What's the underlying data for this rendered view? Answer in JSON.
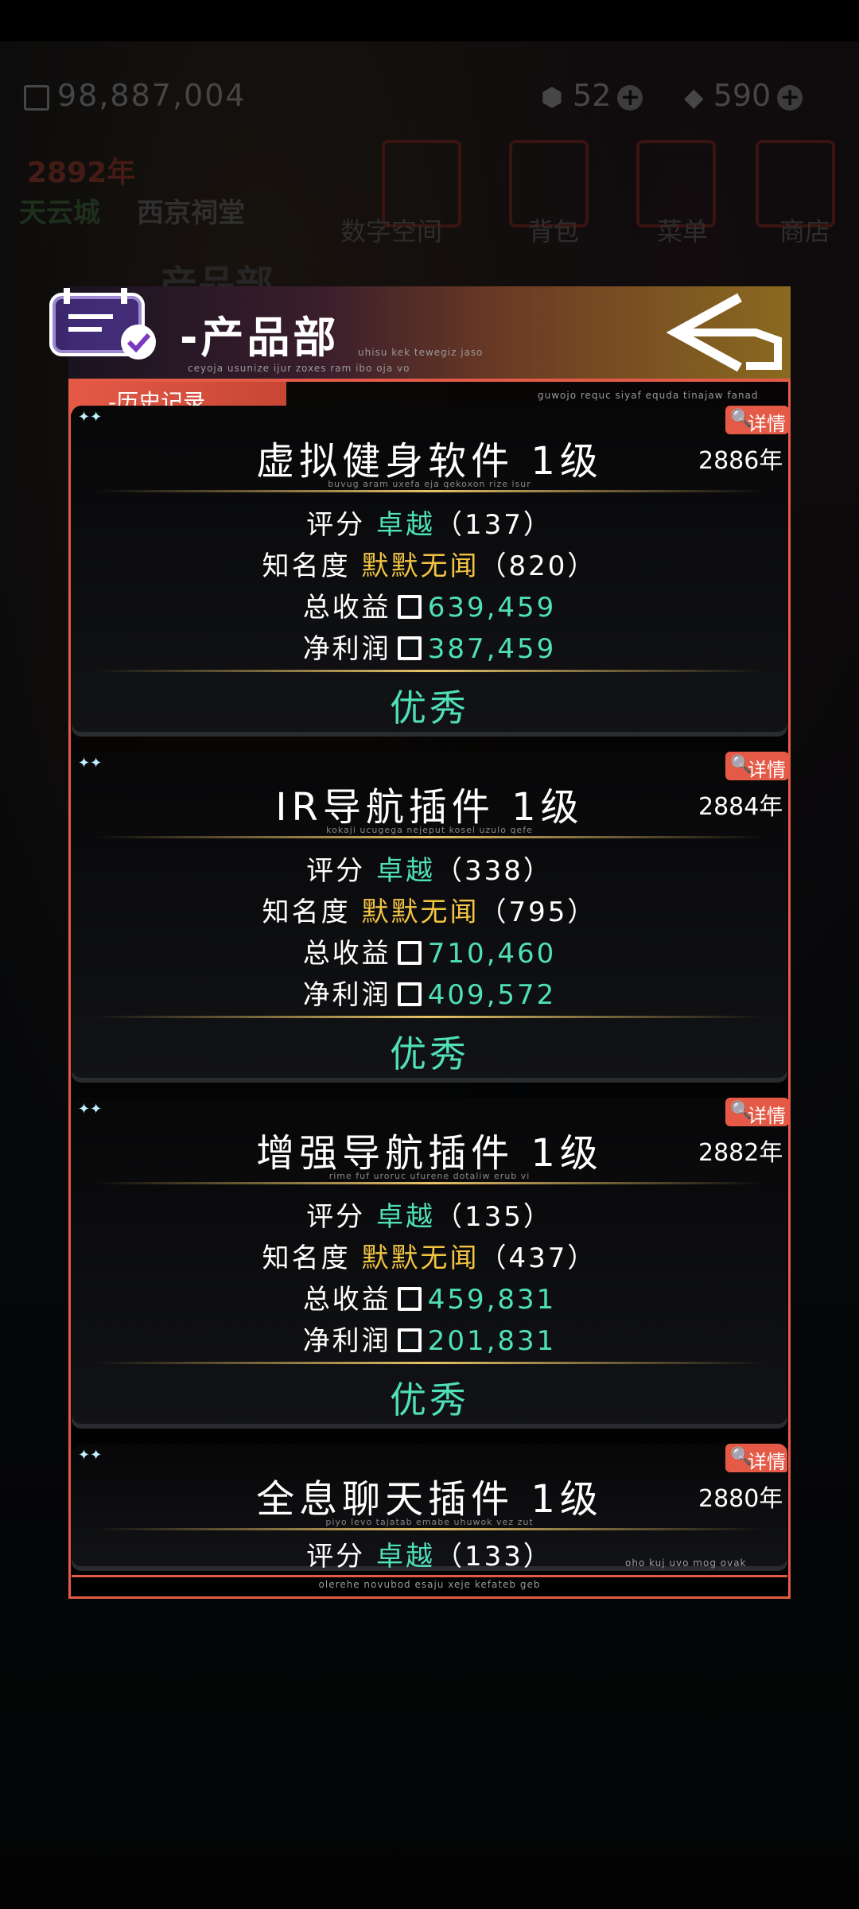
{
  "hud": {
    "money": "98,887,004",
    "res1": "52",
    "res2": "590",
    "year": "2892年",
    "city": "天云城",
    "location": "西京祠堂",
    "nav": [
      "数字空间",
      "背包",
      "菜单",
      "商店"
    ],
    "ghost_title": "产品部"
  },
  "panel": {
    "title": "-产品部",
    "title_sub": "uhisu kek tewegiz jaso",
    "title_sub2": "ceyoja usunize ijur zoxes ram ibo oja vo",
    "tab": "-历史记录",
    "tab_sub": "guwojo requc siyaf equda tinajaw fanad",
    "footer_note": "oho kuj uvo mog ovak",
    "footer_sub": "olerehe novubod esaju xeje kefateb geb"
  },
  "labels": {
    "detail": "详情",
    "score": "评分",
    "fame": "知名度",
    "revenue": "总收益",
    "profit": "净利润",
    "sparkle": "✦✦"
  },
  "products": [
    {
      "name": "虚拟健身软件 1级",
      "sub": "buvug aram uxefa eja qekoxon rize isur",
      "year": "2886年",
      "score_word": "卓越",
      "score_num": "（137）",
      "fame_word": "默默无闻",
      "fame_num": "（820）",
      "revenue": "639,459",
      "profit": "387,459",
      "grade": "优秀"
    },
    {
      "name": "IR导航插件 1级",
      "sub": "kokaji ucugega nejeput kosel uzulo qefe",
      "year": "2884年",
      "score_word": "卓越",
      "score_num": "（338）",
      "fame_word": "默默无闻",
      "fame_num": "（795）",
      "revenue": "710,460",
      "profit": "409,572",
      "grade": "优秀"
    },
    {
      "name": "增强导航插件 1级",
      "sub": "rime fuf uroruc ufurene dotaliw erub vi",
      "year": "2882年",
      "score_word": "卓越",
      "score_num": "（135）",
      "fame_word": "默默无闻",
      "fame_num": "（437）",
      "revenue": "459,831",
      "profit": "201,831",
      "grade": "优秀"
    },
    {
      "name": "全息聊天插件 1级",
      "sub": "piyo levo tajatab emabe uhuwok vez zut",
      "year": "2880年",
      "score_word": "卓越",
      "score_num": "（133）"
    }
  ],
  "colors": {
    "accent": "#e45a47",
    "green": "#4fe0b8",
    "gold": "#f2c443"
  }
}
